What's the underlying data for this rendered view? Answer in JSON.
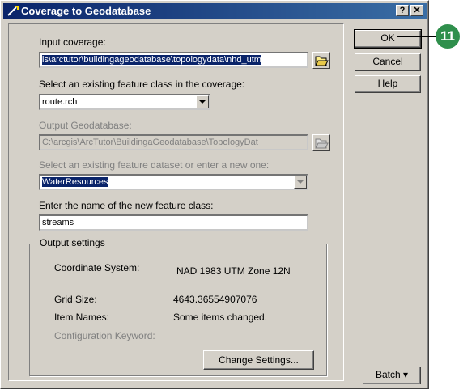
{
  "window": {
    "title": "Coverage to Geodatabase",
    "help_glyph": "?",
    "close_glyph": "✕"
  },
  "form": {
    "input_coverage_label": "Input coverage:",
    "input_coverage_value": "is\\arctutor\\buildingageodatabase\\topologydata\\nhd_utm",
    "feature_class_label": "Select an existing feature class in the coverage:",
    "feature_class_value": "route.rch",
    "output_gdb_label": "Output Geodatabase:",
    "output_gdb_value": "C:\\arcgis\\ArcTutor\\BuildingaGeodatabase\\TopologyDat",
    "dataset_label": "Select an existing feature dataset or enter a new one:",
    "dataset_value": "WaterResources",
    "new_class_label": "Enter the name of the new feature class:",
    "new_class_value": "streams"
  },
  "output_settings": {
    "group_label": "Output settings",
    "coord_label": "Coordinate System:",
    "coord_value": "NAD 1983 UTM Zone 12N",
    "grid_label": "Grid Size:",
    "grid_value": "4643.36554907076",
    "item_label": "Item Names:",
    "item_value": "Some items changed.",
    "config_label": "Configuration Keyword:",
    "change_button": "Change Settings..."
  },
  "buttons": {
    "ok": "OK",
    "cancel": "Cancel",
    "help": "Help",
    "batch": "Batch ▾"
  },
  "callout": {
    "number": "11",
    "color": "#2f8f4c"
  },
  "colors": {
    "titlebar": "#0a246a",
    "face": "#d4d0c8",
    "selection": "#0a246a"
  }
}
